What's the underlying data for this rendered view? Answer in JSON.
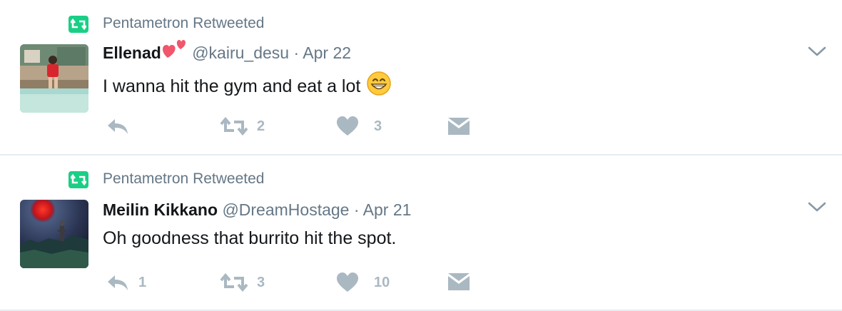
{
  "tweets": [
    {
      "retweet_label": "Pentametron Retweeted",
      "name": "Ellenad",
      "handle": "@kairu_desu",
      "separator": "·",
      "date": "Apr 22",
      "text": "I wanna hit the gym and eat a lot",
      "reply_count": "",
      "retweet_count": "2",
      "like_count": "3"
    },
    {
      "retweet_label": "Pentametron Retweeted",
      "name": "Meilin Kikkano",
      "handle": "@DreamHostage",
      "separator": "·",
      "date": "Apr 21",
      "text": "Oh goodness that burrito hit the spot.",
      "reply_count": "1",
      "retweet_count": "3",
      "like_count": "10"
    }
  ],
  "icons": {
    "retweet_badge": "retweet-badge-icon",
    "reply": "reply-icon",
    "retweet": "retweet-icon",
    "like": "heart-icon",
    "dm": "envelope-icon",
    "more": "chevron-down-icon"
  },
  "colors": {
    "retweet_green": "#19cf86",
    "muted_text": "#657786",
    "action_gray": "#aab8c2",
    "divider": "#e6ecf0"
  }
}
